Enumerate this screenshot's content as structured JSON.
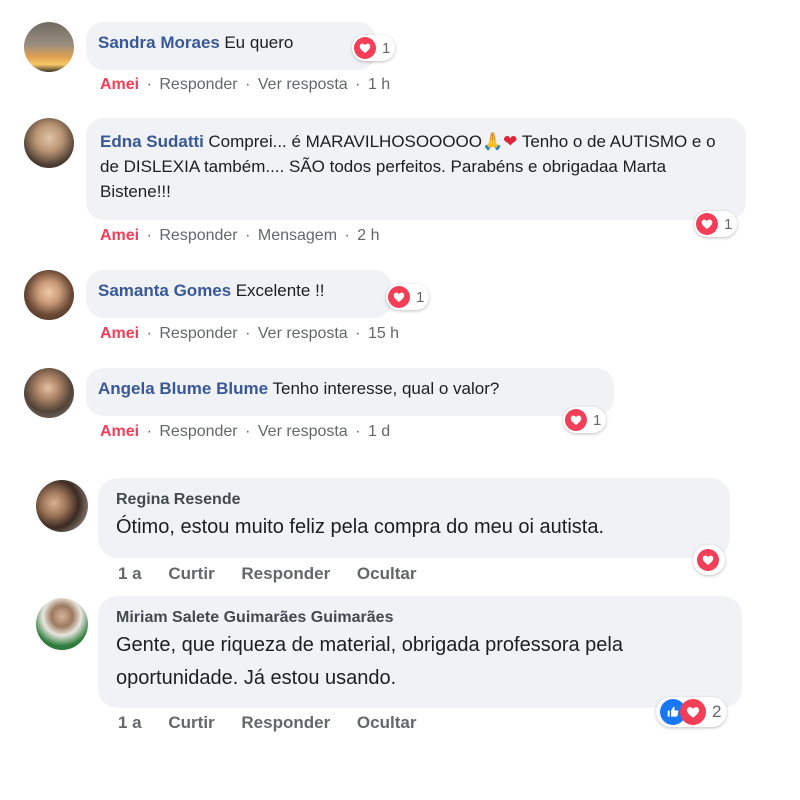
{
  "comments": [
    {
      "name": "Sandra Moraes",
      "text": "Eu quero",
      "reaction_count": "1",
      "actions": {
        "reacted": "Amei",
        "reply": "Responder",
        "link": "Ver resposta",
        "time": "1 h"
      }
    },
    {
      "name": "Edna Sudatti",
      "text": "Comprei... é MARAVILHOSOOOOO",
      "text_end": " Tenho o de AUTISMO e o de DISLEXIA também.... SÃO todos perfeitos. Parabéns e obrigadaa Marta Bistene!!!",
      "emoji_pray": "🙏",
      "emoji_heart": "❤",
      "reaction_count": "1",
      "actions": {
        "reacted": "Amei",
        "reply": "Responder",
        "link": "Mensagem",
        "time": "2 h"
      }
    },
    {
      "name": "Samanta Gomes",
      "text": "Excelente !!",
      "reaction_count": "1",
      "actions": {
        "reacted": "Amei",
        "reply": "Responder",
        "link": "Ver resposta",
        "time": "15 h"
      }
    },
    {
      "name": "Angela Blume Blume",
      "text": "Tenho interesse, qual o valor?",
      "reaction_count": "1",
      "actions": {
        "reacted": "Amei",
        "reply": "Responder",
        "link": "Ver resposta",
        "time": "1 d"
      }
    },
    {
      "name": "Regina Resende",
      "text": "Ótimo, estou muito feliz pela compra do meu oi autista.",
      "actions": {
        "time": "1 a",
        "like": "Curtir",
        "reply": "Responder",
        "hide": "Ocultar"
      }
    },
    {
      "name": "Miriam Salete Guimarães Guimarães",
      "text": "Gente, que riqueza de material, obrigada professora pela oportunidade. Já estou usando.",
      "reaction_count": "2",
      "actions": {
        "time": "1 a",
        "like": "Curtir",
        "reply": "Responder",
        "hide": "Ocultar"
      }
    }
  ],
  "separator": "·",
  "icons": {
    "reaction_love": "heart-icon",
    "reaction_like": "thumbs-up-icon"
  },
  "colors": {
    "love": "#f33e58",
    "like": "#1877f2",
    "name": "#385898",
    "bubble": "#f0f2f5"
  }
}
